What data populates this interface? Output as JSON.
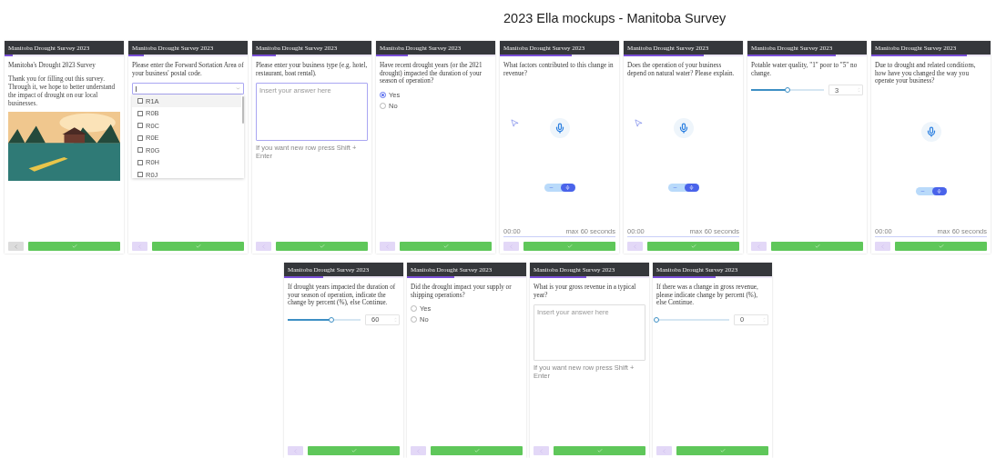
{
  "board": {
    "title": "2023 Ella mockups - Manitoba Survey"
  },
  "rows": [
    {
      "panels": [
        {
          "kind": "intro",
          "header": "Manitoba Drought Survey 2023",
          "progress": {
            "level": 0.07
          },
          "heading": "Manitoba's Drought 2023 Survey",
          "text": "Thank you for filling out this survey. Through it, we hope to better understand the impact of drought on our local businesses.",
          "back_disabled": true
        },
        {
          "kind": "dropdown",
          "header": "Manitoba Drought Survey 2023",
          "progress": {
            "level": 0.13
          },
          "question": "Please enter the Forward Sortation Area of your business' postal code.",
          "options": [
            {
              "label": "R1A",
              "checked": false,
              "selected": true
            },
            {
              "label": "R0B",
              "checked": false,
              "selected": false
            },
            {
              "label": "R0C",
              "checked": false,
              "selected": false
            },
            {
              "label": "R0E",
              "checked": false,
              "selected": false
            },
            {
              "label": "R0G",
              "checked": false,
              "selected": false
            },
            {
              "label": "R0H",
              "checked": false,
              "selected": false
            },
            {
              "label": "R0J",
              "checked": false,
              "selected": false
            }
          ],
          "back_disabled": false
        },
        {
          "kind": "text",
          "header": "Manitoba Drought Survey 2023",
          "progress": {
            "level": 0.2
          },
          "question": "Please enter your business type (e.g. hotel, restaurant, boat rental).",
          "placeholder": "Insert your answer here",
          "hint": "If you want new row press Shift + Enter",
          "focused": true,
          "back_disabled": false
        },
        {
          "kind": "radio",
          "header": "Manitoba Drought Survey 2023",
          "progress": {
            "level": 0.27
          },
          "question": "Have recent drought years (or the 2021 drought) impacted the duration of your season of operation?",
          "options": [
            {
              "label": "Yes",
              "selected": true
            },
            {
              "label": "No",
              "selected": false
            }
          ],
          "back_disabled": false
        },
        {
          "kind": "voice",
          "header": "Manitoba Drought Survey 2023",
          "progress": {
            "level": 0.6
          },
          "question": "What factors contributed to this change in revenue?",
          "cursor_shown": true,
          "time": "00:00",
          "limit": "max 60 seconds",
          "back_disabled": false
        },
        {
          "kind": "voice",
          "header": "Manitoba Drought Survey 2023",
          "progress": {
            "level": 0.67
          },
          "question": "Does the operation of your business depend on natural water? Please explain.",
          "cursor_shown": true,
          "time": "00:00",
          "limit": "max 60 seconds",
          "back_disabled": false
        },
        {
          "kind": "slider",
          "header": "Manitoba Drought Survey 2023",
          "progress": {
            "level": 0.74
          },
          "question": "Potable water quality, \"1\" poor to \"5\" no change.",
          "slider": {
            "level": 0.5
          },
          "value": "3",
          "back_disabled": false
        },
        {
          "kind": "voice",
          "header": "Manitoba Drought Survey 2023",
          "progress": {
            "level": 0.8
          },
          "question": "Due to drought and related conditions, how have you changed the way you operate your business?",
          "cursor_shown": false,
          "time": "00:00",
          "limit": "max 60 seconds",
          "back_disabled": false
        }
      ]
    },
    {
      "panels": [
        {
          "kind": "slider",
          "header": "Manitoba Drought Survey 2023",
          "progress": {
            "level": 0.33
          },
          "question": "If drought years impacted the duration of your season of operation, indicate the change by percent (%), else Continue.",
          "slider": {
            "level": 0.6
          },
          "value": "60",
          "back_disabled": false
        },
        {
          "kind": "radio",
          "header": "Manitoba Drought Survey 2023",
          "progress": {
            "level": 0.4
          },
          "question": "Did the drought impact your supply or shipping operations?",
          "options": [
            {
              "label": "Yes",
              "selected": false
            },
            {
              "label": "No",
              "selected": false
            }
          ],
          "back_disabled": false
        },
        {
          "kind": "text",
          "header": "Manitoba Drought Survey 2023",
          "progress": {
            "level": 0.47
          },
          "question": "What is your gross revenue in a typical year?",
          "placeholder": "Insert your answer here",
          "hint": "If you want new row press Shift + Enter",
          "focused": false,
          "back_disabled": false
        },
        {
          "kind": "slider",
          "header": "Manitoba Drought Survey 2023",
          "progress": {
            "level": 0.53
          },
          "question": "If there was a change in gross revenue, please indicate change by percent (%), else Continue.",
          "slider": {
            "level": 0
          },
          "value": "0",
          "back_disabled": false
        }
      ]
    }
  ]
}
